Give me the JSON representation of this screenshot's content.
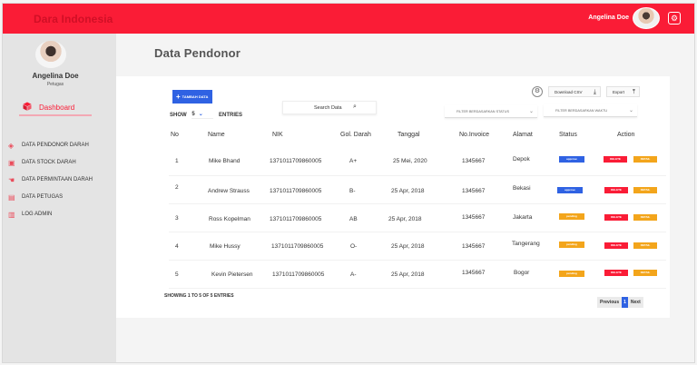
{
  "header": {
    "brand": "Dara Indonesia",
    "user_name": "Angelina Doe"
  },
  "sidebar": {
    "name": "Angelina Doe",
    "role": "Petugas",
    "dashboard_label": "Dashboard",
    "items": [
      {
        "label": "DATA PENDONOR DARAH",
        "icon": "blood-drop-icon"
      },
      {
        "label": "DATA STOCK DARAH",
        "icon": "truck-icon"
      },
      {
        "label": "DATA PERMINTAAN DARAH",
        "icon": "hand-icon"
      },
      {
        "label": "DATA PETUGAS",
        "icon": "clipboard-icon"
      },
      {
        "label": "LOG ADMIN",
        "icon": "document-icon"
      }
    ]
  },
  "page": {
    "title": "Data Pendonor"
  },
  "toolbar": {
    "add_label": "TAMBAH DATA",
    "show_label": "SHOW",
    "show_value": "5",
    "entries_label": "ENTRIES",
    "search_placeholder": "Search Data",
    "download_label": "Download CSV",
    "export_label": "Export",
    "filter_status": "FILTER BERDASARKAN STATUS",
    "filter_waktu": "FILTER BERDASARKAN WAKTU"
  },
  "table": {
    "headers": [
      "No",
      "Name",
      "NIK",
      "Gol. Darah",
      "Tanggal",
      "No.Invoice",
      "Alamat",
      "Status",
      "Action"
    ],
    "rows": [
      {
        "no": "1",
        "name": "Mike Bhand",
        "nik": "1371011709860005",
        "gol": "A+",
        "tanggal": "25 Mei, 2020",
        "invoice": "1345667",
        "alamat": "Depok",
        "status": "approve",
        "status_label": "approve"
      },
      {
        "no": "2",
        "name": "Andrew Strauss",
        "nik": "1371011709860005",
        "gol": "B-",
        "tanggal": "25 Apr, 2018",
        "invoice": "1345667",
        "alamat": "Bekasi",
        "status": "approve",
        "status_label": "approve"
      },
      {
        "no": "3",
        "name": "Ross Kopelman",
        "nik": "1371011709860005",
        "gol": "AB",
        "tanggal": "25 Apr, 2018",
        "invoice": "1345667",
        "alamat": "Jakarta",
        "status": "pending",
        "status_label": "pending"
      },
      {
        "no": "4",
        "name": "Mike Hussy",
        "nik": "1371011709860005",
        "gol": "O-",
        "tanggal": "25 Apr, 2018",
        "invoice": "1345667",
        "alamat": "Tangerang",
        "status": "pending",
        "status_label": "pending"
      },
      {
        "no": "5",
        "name": "Kevin Pietersen",
        "nik": "1371011709860005",
        "gol": "A-",
        "tanggal": "25 Apr, 2018",
        "invoice": "1345667",
        "alamat": "Bogor",
        "status": "pending",
        "status_label": "pending"
      }
    ],
    "delete_label": "DELETE",
    "detail_label": "DETAIL"
  },
  "footer": {
    "showing": "SHOWING 1 TO 5 OF 5 ENTRIES",
    "prev": "Previous",
    "page": "1",
    "next": "Next"
  },
  "colors": {
    "accent": "#fa1c36",
    "primary": "#2f62e3",
    "warning": "#f3a51b"
  }
}
